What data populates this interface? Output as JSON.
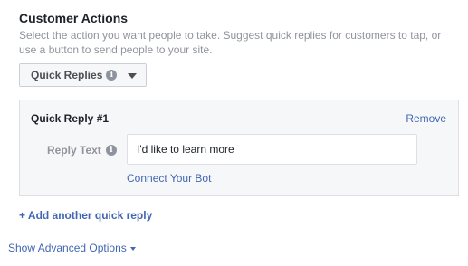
{
  "section": {
    "title": "Customer Actions",
    "description": "Select the action you want people to take. Suggest quick replies for customers to tap, or use a button to send people to your site."
  },
  "action_dropdown": {
    "selected": "Quick Replies",
    "info_icon": "info-icon",
    "caret_icon": "caret-down-icon"
  },
  "quick_reply": {
    "header": "Quick Reply #1",
    "remove_label": "Remove",
    "field_label": "Reply Text",
    "field_value": "I'd like to learn more",
    "connect_label": "Connect Your Bot"
  },
  "add_reply_label": "+ Add another quick reply",
  "advanced_options_label": "Show Advanced Options",
  "colors": {
    "link": "#4267b2",
    "panel_bg": "#f6f7f9",
    "muted_text": "#90949c"
  }
}
